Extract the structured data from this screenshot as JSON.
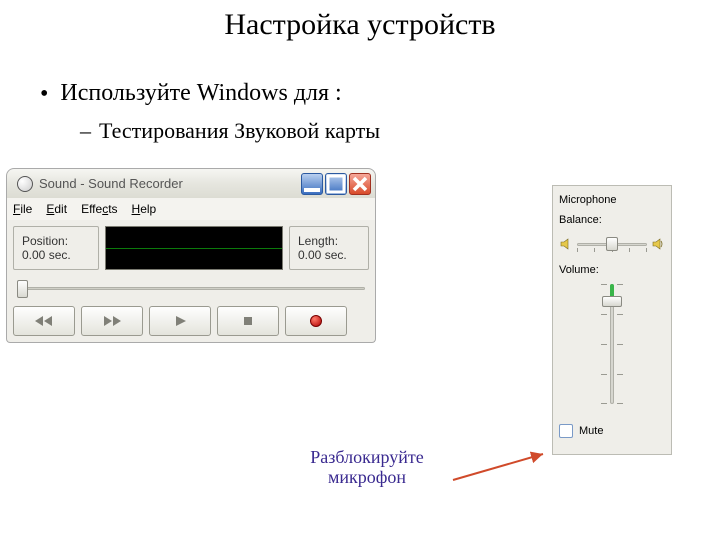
{
  "slide": {
    "title": "Настройка устройств",
    "bullet1": "Используйте  Windows для :",
    "bullet2": "Тестирования Звуковой карты",
    "note_line1": "Разблокируйте",
    "note_line2": "микрофон"
  },
  "recorder": {
    "window_title": "Sound - Sound Recorder",
    "menu": {
      "file": "File",
      "edit": "Edit",
      "effects": "Effects",
      "help": "Help"
    },
    "position_label": "Position:",
    "position_value": "0.00 sec.",
    "length_label": "Length:",
    "length_value": "0.00 sec.",
    "icons": {
      "app": "recorder-app-icon",
      "minimize": "minimize-icon",
      "maximize": "maximize-icon",
      "close": "close-icon",
      "rewind": "seek-start-icon",
      "forward": "seek-end-icon",
      "play": "play-icon",
      "stop": "stop-icon",
      "record": "record-icon"
    }
  },
  "mixer": {
    "title": "Microphone",
    "balance_label": "Balance:",
    "volume_label": "Volume:",
    "mute_label": "Mute",
    "mute_checked": false,
    "icons": {
      "speaker_left": "speaker-left-icon",
      "speaker_right": "speaker-right-icon"
    }
  }
}
